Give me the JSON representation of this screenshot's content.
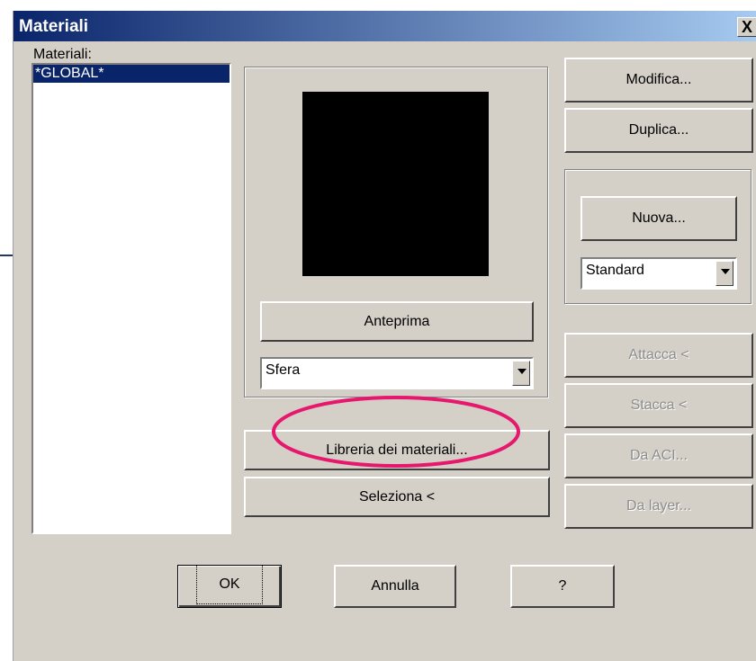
{
  "dialog": {
    "title": "Materiali",
    "close_label": "X"
  },
  "materials_list": {
    "label": "Materiali:",
    "items": [
      "*GLOBAL*"
    ]
  },
  "preview": {
    "button_label": "Anteprima",
    "shape_value": "Sfera"
  },
  "buttons": {
    "modify": "Modifica...",
    "duplicate": "Duplica...",
    "new": "Nuova...",
    "attach": "Attacca <",
    "detach": "Stacca <",
    "by_aci": "Da ACI...",
    "by_layer": "Da layer...",
    "library": "Libreria dei materiali...",
    "select": "Seleziona <",
    "ok": "OK",
    "cancel": "Annulla",
    "help": "?"
  },
  "type_select": {
    "value": "Standard"
  },
  "colors": {
    "title_start": "#0a246a",
    "title_end": "#a6caf0",
    "selection": "#0a246a",
    "annotation_arrow": "#1f3864",
    "annotation_ellipse": "#e5186e"
  }
}
